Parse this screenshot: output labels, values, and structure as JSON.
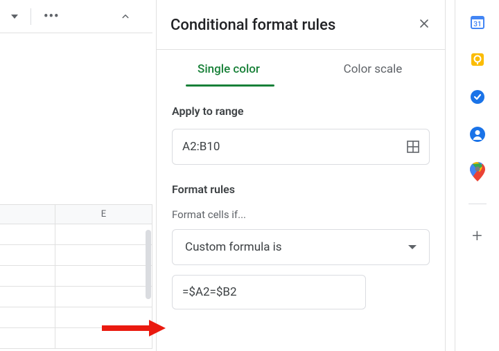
{
  "panel": {
    "title": "Conditional format rules",
    "tabs": {
      "single": "Single color",
      "scale": "Color scale"
    },
    "apply_label": "Apply to range",
    "range_value": "A2:B10",
    "rules_label": "Format rules",
    "cells_if_label": "Format cells if...",
    "condition_select": "Custom formula is",
    "formula_value": "=$A2=$B2"
  },
  "sheet": {
    "column_header": "E"
  },
  "rail": {
    "calendar_day": "31"
  }
}
